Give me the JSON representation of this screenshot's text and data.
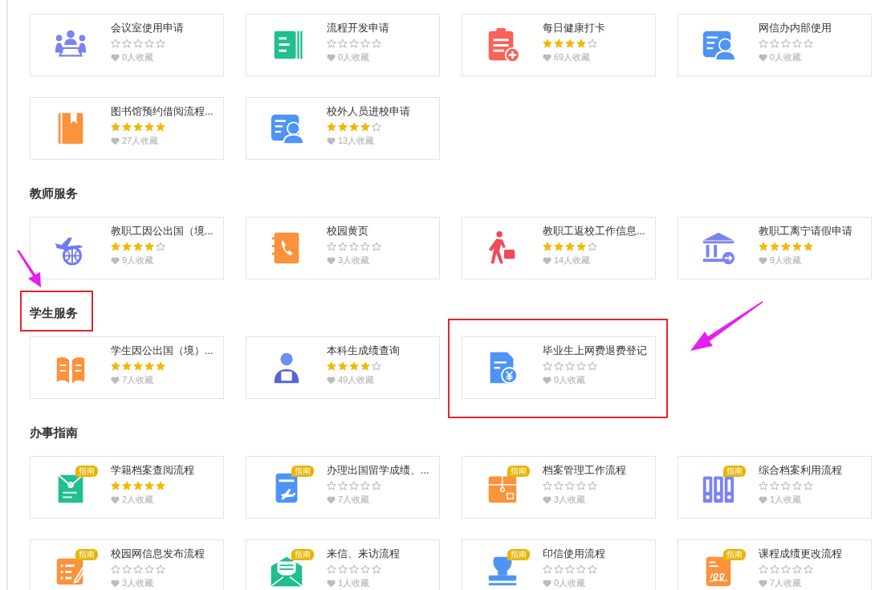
{
  "sections": [
    {
      "highlighted": false,
      "cards": [
        {
          "title": "会议室使用申请",
          "stars": 0,
          "favorites": "0人收藏",
          "highlighted": false
        },
        {
          "title": "流程开发申请",
          "stars": 0,
          "favorites": "0人收藏",
          "highlighted": false
        },
        {
          "title": "每日健康打卡",
          "stars": 4,
          "favorites": "69人收藏",
          "highlighted": false
        },
        {
          "title": "网信办内部使用",
          "stars": 0,
          "favorites": "0人收藏",
          "highlighted": false
        },
        {
          "title": "图书馆预约借阅流程...",
          "stars": 5,
          "favorites": "27人收藏",
          "highlighted": false
        },
        {
          "title": "校外人员进校申请",
          "stars": 4,
          "favorites": "13人收藏",
          "highlighted": false
        }
      ]
    },
    {
      "title": "教师服务",
      "highlighted": false,
      "cards": [
        {
          "title": "教职工因公出国（境...",
          "stars": 4,
          "favorites": "9人收藏",
          "highlighted": false
        },
        {
          "title": "校园黄页",
          "stars": 0,
          "favorites": "3人收藏",
          "highlighted": false
        },
        {
          "title": "教职工返校工作信息...",
          "stars": 4,
          "favorites": "14人收藏",
          "highlighted": false
        },
        {
          "title": "教职工离宁请假申请",
          "stars": 5,
          "favorites": "9人收藏",
          "highlighted": false
        }
      ]
    },
    {
      "title": "学生服务",
      "highlighted": true,
      "cards": [
        {
          "title": "学生因公出国（境）...",
          "stars": 5,
          "favorites": "7人收藏",
          "highlighted": false
        },
        {
          "title": "本科生成绩查询",
          "stars": 4,
          "favorites": "49人收藏",
          "highlighted": false
        },
        {
          "title": "毕业生上网费退费登记",
          "stars": 0,
          "favorites": "0人收藏",
          "highlighted": true
        }
      ]
    },
    {
      "title": "办事指南",
      "highlighted": false,
      "cards": [
        {
          "title": "学籍档案查阅流程",
          "badge": "指南",
          "stars": 5,
          "favorites": "2人收藏",
          "highlighted": false
        },
        {
          "title": "办理出国留学成绩、...",
          "badge": "指南",
          "stars": 0,
          "favorites": "7人收藏",
          "highlighted": false
        },
        {
          "title": "档案管理工作流程",
          "badge": "指南",
          "stars": 0,
          "favorites": "3人收藏",
          "highlighted": false
        },
        {
          "title": "综合档案利用流程",
          "badge": "指南",
          "stars": 0,
          "favorites": "1人收藏",
          "highlighted": false
        },
        {
          "title": "校园网信息发布流程",
          "badge": "指南",
          "stars": 0,
          "favorites": "3人收藏",
          "highlighted": false
        },
        {
          "title": "来信、来访流程",
          "badge": "指南",
          "stars": 0,
          "favorites": "1人收藏",
          "highlighted": false
        },
        {
          "title": "印信使用流程",
          "badge": "指南",
          "stars": 0,
          "favorites": "0人收藏",
          "highlighted": false
        },
        {
          "title": "课程成绩更改流程",
          "badge": "指南",
          "stars": 0,
          "favorites": "7人收藏",
          "highlighted": false
        }
      ]
    }
  ]
}
